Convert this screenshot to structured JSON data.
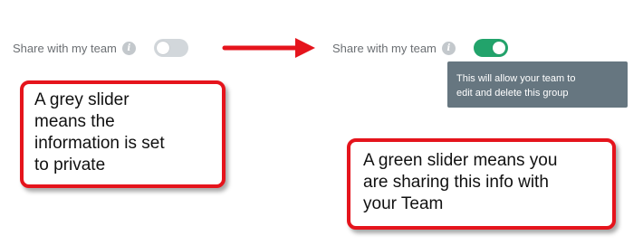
{
  "colors": {
    "toggle_off": "#d2d7db",
    "toggle_on": "#22a36b",
    "tooltip_bg": "#667680",
    "annotation_red": "#e5141c",
    "info_icon": "#c3c8cc"
  },
  "left_setting": {
    "label": "Share with my team",
    "info_icon": "info-icon",
    "toggle_state": "off"
  },
  "right_setting": {
    "label": "Share with my team",
    "info_icon": "info-icon",
    "toggle_state": "on"
  },
  "tooltip": {
    "line1": "This will allow your team to",
    "line2": "edit and delete this group"
  },
  "annotations": {
    "grey_slider": {
      "line1": "A grey slider",
      "line2": "means the",
      "line3": "information is set",
      "line4": "to private"
    },
    "green_slider": {
      "line1": "A green slider means you",
      "line2": "are sharing this info with",
      "line3": "your Team"
    }
  }
}
